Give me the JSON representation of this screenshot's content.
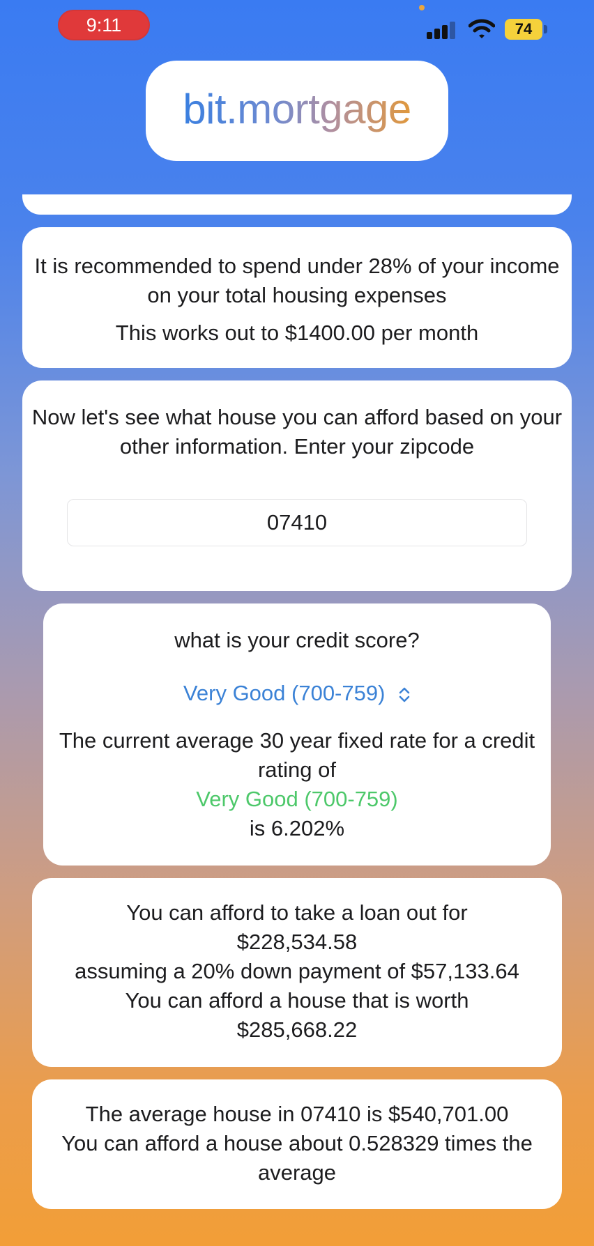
{
  "status_bar": {
    "time": "9:11",
    "battery_level": "74",
    "icons": [
      "cellular-signal-icon",
      "wifi-icon",
      "battery-icon"
    ]
  },
  "app": {
    "logo_text": "bit.mortgage"
  },
  "recommendation": {
    "line1": "It is recommended to spend under 28% of your income on your total housing expenses",
    "line2": "This works out to $1400.00 per month"
  },
  "zipcode": {
    "prompt": "Now let's see what house you can afford based on your other information. Enter your zipcode",
    "value": "07410"
  },
  "credit": {
    "question": "what is your credit score?",
    "selected_option": "Very Good (700-759)",
    "rate_intro": "The current average 30 year fixed rate for a credit rating of",
    "rating": "Very Good (700-759)",
    "rate": "is 6.202%"
  },
  "loan": {
    "line1": "You can afford to take a loan out for",
    "loan_amount": "$228,534.58",
    "line2": "assuming a 20% down payment of $57,133.64",
    "line3": "You can afford a house that is worth",
    "house_value": "$285,668.22"
  },
  "average": {
    "line1": "The average house in 07410 is $540,701.00",
    "line2": "You can afford a house about 0.528329 times the average"
  },
  "colors": {
    "link_blue": "#3b82d6",
    "rating_green": "#4dc86a",
    "time_pill_red": "#e0393a",
    "battery_yellow": "#f5d13b"
  }
}
